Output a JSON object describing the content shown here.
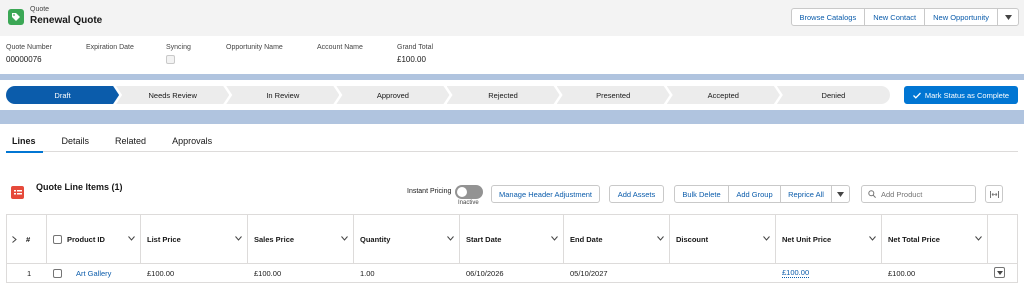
{
  "record": {
    "object_type": "Quote",
    "title": "Renewal Quote"
  },
  "header_actions": [
    "Browse Catalogs",
    "New Contact",
    "New Opportunity"
  ],
  "fields": [
    {
      "label": "Quote Number",
      "value": "00000076"
    },
    {
      "label": "Expiration Date",
      "value": ""
    },
    {
      "label": "Syncing",
      "value": ""
    },
    {
      "label": "Opportunity Name",
      "value": ""
    },
    {
      "label": "Account Name",
      "value": ""
    },
    {
      "label": "Grand Total",
      "value": "£100.00"
    }
  ],
  "path": {
    "stages": [
      "Draft",
      "Needs Review",
      "In Review",
      "Approved",
      "Rejected",
      "Presented",
      "Accepted",
      "Denied"
    ],
    "active_index": 0,
    "mark_button": "Mark Status as Complete"
  },
  "tabs": [
    "Lines",
    "Details",
    "Related",
    "Approvals"
  ],
  "related_list": {
    "title": "Quote Line Items (1)",
    "instant_pricing_label": "Instant Pricing",
    "instant_pricing_state": "Inactive",
    "buttons": {
      "manage_header": "Manage Header Adjustment",
      "add_assets": "Add Assets",
      "bulk_delete": "Bulk Delete",
      "add_group": "Add Group",
      "reprice_all": "Reprice All"
    },
    "search_placeholder": "Add Product"
  },
  "table": {
    "columns": [
      "#",
      "Product ID",
      "List Price",
      "Sales Price",
      "Quantity",
      "Start Date",
      "End Date",
      "Discount",
      "Net Unit Price",
      "Net Total Price"
    ],
    "rows": [
      {
        "num": "1",
        "product": "Art Gallery",
        "list_price": "£100.00",
        "sales_price": "£100.00",
        "quantity": "1.00",
        "start_date": "06/10/2026",
        "end_date": "05/10/2027",
        "discount": "",
        "net_unit_price": "£100.00",
        "net_total_price": "£100.00"
      }
    ]
  },
  "colors": {
    "brand": "#0176d3",
    "path_active": "#0b5cab",
    "quote_icon": "#3ba755",
    "list_icon": "#e64a3b"
  }
}
